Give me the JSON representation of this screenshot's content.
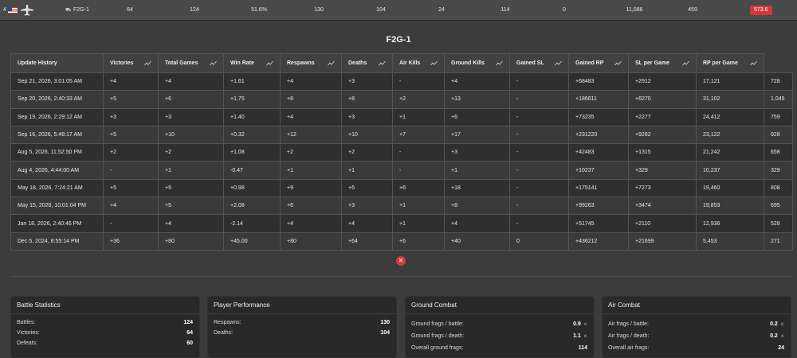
{
  "summary": {
    "rank": "4",
    "country": "usa",
    "type_glyph": "⛟",
    "name": "F2G-1",
    "values": [
      "64",
      "124",
      "51.6%",
      "130",
      "104",
      "24",
      "114",
      "0",
      "11,086",
      "459"
    ],
    "rating": "573.6",
    "rating_color": "#d23636"
  },
  "title": "F2G-1",
  "table": {
    "headers": [
      "Update History",
      "Victories",
      "Total Games",
      "Win Rate",
      "Respawns",
      "Deaths",
      "Air Kills",
      "Ground Kills",
      "Gained SL",
      "Gained RP",
      "SL per Game",
      "RP per Game"
    ],
    "rows": [
      [
        "Sep 21, 2026, 3:01:05 AM",
        "+4",
        "+4",
        "+1.61",
        "+4",
        "+3",
        "-",
        "+4",
        "-",
        "+68483",
        "+2912",
        "17,121",
        "728"
      ],
      [
        "Sep 20, 2026, 2:40:33 AM",
        "+5",
        "+6",
        "+1.75",
        "+8",
        "+8",
        "+2",
        "+13",
        "-",
        "+186611",
        "+6270",
        "31,102",
        "1,045"
      ],
      [
        "Sep 19, 2026, 2:29:12 AM",
        "+3",
        "+3",
        "+1.40",
        "+4",
        "+3",
        "+1",
        "+6",
        "-",
        "+73235",
        "+2277",
        "24,412",
        "759"
      ],
      [
        "Sep 16, 2026, 5:48:17 AM",
        "+5",
        "+10",
        "+0.32",
        "+12",
        "+10",
        "+7",
        "+17",
        "-",
        "+231220",
        "+9282",
        "23,122",
        "928"
      ],
      [
        "Aug 5, 2026, 11:52:50 PM",
        "+2",
        "+2",
        "+1.08",
        "+2",
        "+2",
        "-",
        "+3",
        "-",
        "+42483",
        "+1315",
        "21,242",
        "658"
      ],
      [
        "Aug 4, 2026, 4:44:00 AM",
        "-",
        "+1",
        "-0.47",
        "+1",
        "+1",
        "-",
        "+1",
        "-",
        "+10237",
        "+329",
        "10,237",
        "329"
      ],
      [
        "May 18, 2026, 7:24:21 AM",
        "+5",
        "+9",
        "+0.98",
        "+9",
        "+6",
        "+6",
        "+18",
        "-",
        "+175141",
        "+7273",
        "19,460",
        "808"
      ],
      [
        "May 15, 2026, 10:01:04 PM",
        "+4",
        "+5",
        "+2.08",
        "+6",
        "+3",
        "+1",
        "+8",
        "-",
        "+99263",
        "+3474",
        "19,853",
        "695"
      ],
      [
        "Jan 18, 2026, 2:40:46 PM",
        "-",
        "+4",
        "-2.14",
        "+4",
        "+4",
        "+1",
        "+4",
        "-",
        "+51745",
        "+2110",
        "12,936",
        "528"
      ],
      [
        "Dec 5, 2024, 8:55:14 PM",
        "+36",
        "+80",
        "+45.00",
        "+80",
        "+64",
        "+6",
        "+40",
        "0",
        "+436212",
        "+21699",
        "5,453",
        "271"
      ]
    ]
  },
  "cards": [
    {
      "title": "Battle Statistics",
      "rows": [
        {
          "label": "Battles:",
          "value": "124"
        },
        {
          "label": "Victories:",
          "value": "64"
        },
        {
          "label": "Defeats:",
          "value": "60"
        }
      ]
    },
    {
      "title": "Player Performance",
      "rows": [
        {
          "label": "Respawns:",
          "value": "130"
        },
        {
          "label": "Deaths:",
          "value": "104"
        }
      ]
    },
    {
      "title": "Ground Combat",
      "rows": [
        {
          "label": "Ground frags / battle:",
          "value": "0.9",
          "unit": "d."
        },
        {
          "label": "Ground frags / death:",
          "value": "1.1",
          "unit": "d."
        },
        {
          "label": "Overall ground frags:",
          "value": "114"
        }
      ]
    },
    {
      "title": "Air Combat",
      "rows": [
        {
          "label": "Air frags / battle:",
          "value": "0.2",
          "unit": "d."
        },
        {
          "label": "Air frags / death:",
          "value": "0.2",
          "unit": "d."
        },
        {
          "label": "Overall air frags:",
          "value": "24"
        }
      ]
    }
  ],
  "close_glyph": "✕",
  "icons": {
    "plane": "aircraft-icon",
    "trend": "trend-chart-icon",
    "flag": "usa-flag-icon",
    "close": "close-icon"
  }
}
